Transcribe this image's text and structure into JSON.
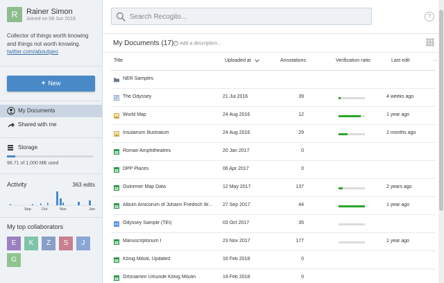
{
  "profile": {
    "initial": "R",
    "name": "Rainer Simon",
    "joined": "Joined on 08 Jun 2016",
    "bio": "Collector of things worth knowing and things not worth knowing.",
    "twitter": "twitter.com/aboutgeo",
    "avatar_color": "#8fbc8f"
  },
  "new_button": {
    "label": "New"
  },
  "nav": [
    {
      "label": "My Documents",
      "icon": "user-circle-icon",
      "active": true
    },
    {
      "label": "Shared with me",
      "icon": "share-icon",
      "active": false
    }
  ],
  "storage": {
    "label": "Storage",
    "text": "96.71 of 1,000 MB used",
    "used_fraction": 0.097
  },
  "activity": {
    "title": "Activity",
    "count": "363 edits",
    "months": [
      "Sep",
      "Oct",
      "Nov",
      "Jan"
    ]
  },
  "collaborators": {
    "title": "My top collaborators",
    "items": [
      {
        "initial": "E",
        "color": "#9b7fc0"
      },
      {
        "initial": "K",
        "color": "#7fc4a8"
      },
      {
        "initial": "Z",
        "color": "#8a9fc8"
      },
      {
        "initial": "S",
        "color": "#c87f8f"
      },
      {
        "initial": "J",
        "color": "#8aa6d4"
      },
      {
        "initial": "G",
        "color": "#8fc48f"
      }
    ]
  },
  "search": {
    "placeholder": "Search Recogito..."
  },
  "help": {
    "label": "?"
  },
  "documents": {
    "title": "My Documents (17)",
    "add_description": "Add a description...",
    "columns": {
      "title": "Title",
      "uploaded": "Uploaded at",
      "annotations": "Annotations",
      "verification": "Verification ratio",
      "last_edit": "Last edit",
      "more": "···"
    },
    "rows": [
      {
        "type": "folder",
        "title": "NER Samples",
        "uploaded": "",
        "annotations": "",
        "ratio": null,
        "last_edit": ""
      },
      {
        "type": "text",
        "title": "The Odyssey",
        "uploaded": "21 Jul 2016",
        "annotations": "39",
        "ratio": 0.08,
        "last_edit": "4 weeks ago"
      },
      {
        "type": "image",
        "title": "World Map",
        "uploaded": "24 Aug 2016",
        "annotations": "12",
        "ratio": 0.85,
        "last_edit": "1 year ago"
      },
      {
        "type": "image",
        "title": "Insularium Illustratum",
        "uploaded": "24 Aug 2016",
        "annotations": "29",
        "ratio": 0.35,
        "last_edit": "2 months ago"
      },
      {
        "type": "table",
        "title": "Roman Amphitheatres",
        "uploaded": "20 Jan 2017",
        "annotations": "0",
        "ratio": null,
        "last_edit": ""
      },
      {
        "type": "table",
        "title": "DPP Places",
        "uploaded": "06 Apr 2017",
        "annotations": "0",
        "ratio": null,
        "last_edit": ""
      },
      {
        "type": "table",
        "title": "Outremer Map Data",
        "uploaded": "12 May 2017",
        "annotations": "137",
        "ratio": 0.15,
        "last_edit": "2 years ago"
      },
      {
        "type": "table",
        "title": "Album Amicorum of Johann Friedrich W...",
        "uploaded": "27 Sep 2017",
        "annotations": "44",
        "ratio": 1.0,
        "last_edit": "1 year ago"
      },
      {
        "type": "tei",
        "title": "Odyssey Sample (TEI)",
        "uploaded": "03 Oct 2017",
        "annotations": "35",
        "ratio": 0.0,
        "last_edit": ""
      },
      {
        "type": "table",
        "title": "Manuscriptorium I",
        "uploaded": "23 Nov 2017",
        "annotations": "177",
        "ratio": 0.0,
        "last_edit": "1 year ago"
      },
      {
        "type": "table",
        "title": "König Milutil, Updated",
        "uploaded": "16 Feb 2018",
        "annotations": "0",
        "ratio": null,
        "last_edit": ""
      },
      {
        "type": "table",
        "title": "Ortsnamen Urkunde König Milutin",
        "uploaded": "19 Feb 2018",
        "annotations": "0",
        "ratio": null,
        "last_edit": ""
      }
    ]
  },
  "colors": {
    "accent": "#4a89c8",
    "verified": "#2aa52a",
    "sidebar_bg": "#eff2f5"
  }
}
